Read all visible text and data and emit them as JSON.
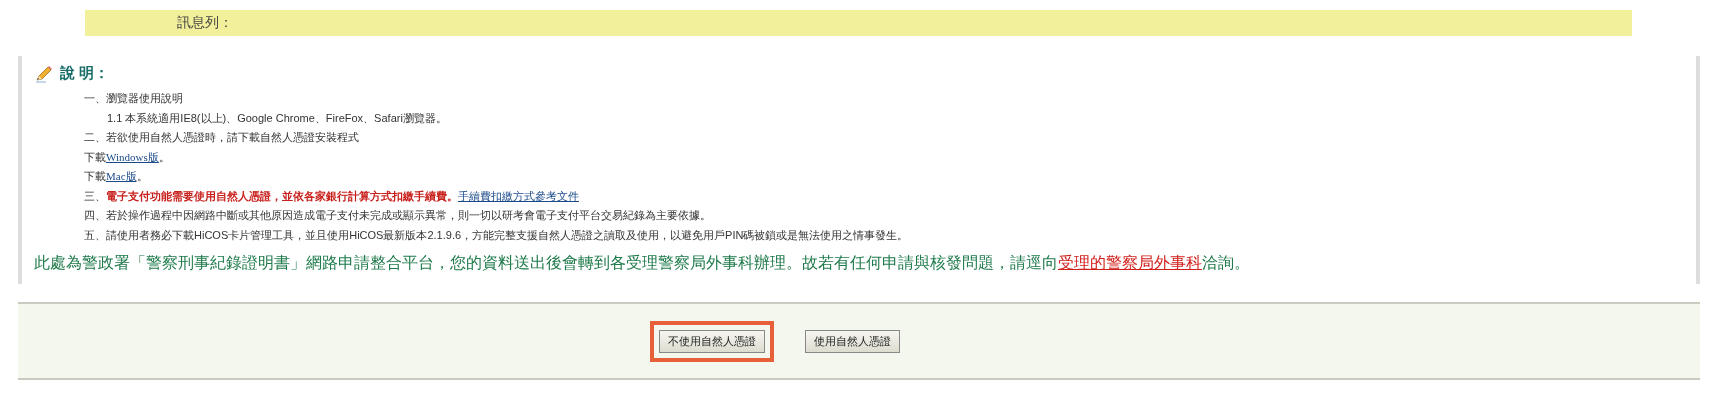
{
  "message_bar": {
    "label": "訊息列："
  },
  "notes": {
    "heading": "說 明：",
    "lines": [
      {
        "segments": [
          {
            "kind": "plain",
            "text": "一、瀏覽器使用說明"
          }
        ],
        "children": [
          {
            "segments": [
              {
                "kind": "plain",
                "text": "1.1 本系統適用IE8(以上)、Google Chrome、FireFox、Safari瀏覽器。"
              }
            ]
          }
        ]
      },
      {
        "segments": [
          {
            "kind": "plain",
            "text": "二、若欲使用自然人憑證時，請下載自然人憑證安裝程式"
          }
        ]
      },
      {
        "segments": [
          {
            "kind": "plain",
            "text": "下載"
          },
          {
            "kind": "link",
            "text": "Windows版"
          },
          {
            "kind": "plain",
            "text": "。"
          }
        ]
      },
      {
        "segments": [
          {
            "kind": "plain",
            "text": "下載"
          },
          {
            "kind": "link",
            "text": "Mac版"
          },
          {
            "kind": "plain",
            "text": "。"
          }
        ]
      },
      {
        "segments": [
          {
            "kind": "plain",
            "text": "三、"
          },
          {
            "kind": "alert",
            "text": "電子支付功能需要使用自然人憑證，並依各家銀行計算方式扣繳手續費。"
          },
          {
            "kind": "link",
            "text": "手續費扣繳方式參考文件"
          }
        ]
      },
      {
        "segments": [
          {
            "kind": "plain",
            "text": "四、若於操作過程中因網路中斷或其他原因造成電子支付未完成或顯示異常，則一切以研考會電子支付平台交易紀錄為主要依據。"
          }
        ]
      },
      {
        "segments": [
          {
            "kind": "plain",
            "text": "五、請使用者務必下載HiCOS卡片管理工具，並且使用HiCOS最新版本2.1.9.6，方能完整支援自然人憑證之讀取及使用，以避免用戶PIN碼被鎖或是無法使用之情事發生。"
          }
        ]
      }
    ],
    "notice": [
      {
        "kind": "plain",
        "text": "此處為警政署「警察刑事紀錄證明書」網路申請整合平台，您的資料送出後會轉到各受理警察局外事科辦理。故若有任何申請與核發問題，請逕向"
      },
      {
        "kind": "alert_link",
        "text": "受理的警察局外事科"
      },
      {
        "kind": "plain",
        "text": "洽詢。"
      }
    ]
  },
  "buttons": [
    {
      "label": "不使用自然人憑證",
      "highlighted": true
    },
    {
      "label": "使用自然人憑證",
      "highlighted": false
    }
  ]
}
